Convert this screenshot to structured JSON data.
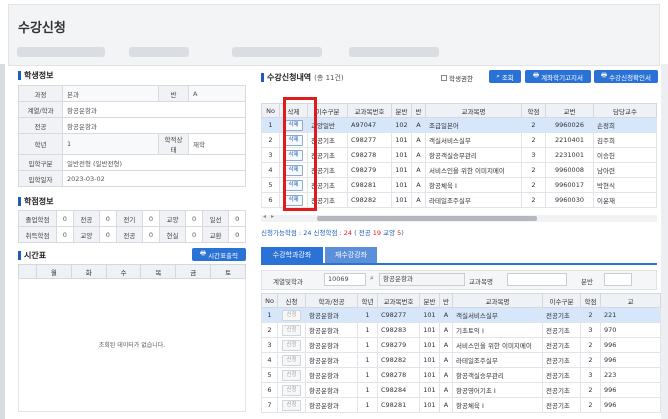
{
  "page": {
    "title": "수강신청"
  },
  "student": {
    "section_title": "학생정보",
    "rows": [
      {
        "label": "과정",
        "value": "본과",
        "label2": "반",
        "value2": "A"
      },
      {
        "label": "계열/학과",
        "value": "항공운항과"
      },
      {
        "label": "전공",
        "value": "항공운항과"
      },
      {
        "label": "학년",
        "value": "1",
        "label2": "학적상태",
        "value2": "재학"
      },
      {
        "label": "입학구분",
        "value": "일반전형 (일반전형)"
      },
      {
        "label": "입학일자",
        "value": "2023-03-02"
      }
    ]
  },
  "credits": {
    "section_title": "학점정보",
    "row1": {
      "label": "졸업학점",
      "cells": [
        "0",
        "전공",
        "0",
        "전기",
        "0",
        "교양",
        "0",
        "일선",
        "0"
      ]
    },
    "row2": {
      "label": "취득학점",
      "cells": [
        "0",
        "교양",
        "0",
        "전공",
        "0",
        "현실",
        "0",
        "교환",
        "0"
      ]
    }
  },
  "timetable": {
    "section_title": "시간표",
    "print_button": "시간표출력",
    "days": [
      "월",
      "화",
      "수",
      "목",
      "금",
      "토"
    ],
    "empty_message": "조회된 데이터가 없습니다."
  },
  "enroll": {
    "section_title": "수강신청내역",
    "count_text": "(총 11건)",
    "checkbox_label": "학생권한",
    "buttons": {
      "search": "조회",
      "notice": "계좌학기고지서",
      "confirm": "수강신청확인서"
    },
    "columns": [
      "No",
      "삭제",
      "이수구분",
      "교과목번호",
      "분반",
      "반",
      "교과목명",
      "학점",
      "교번",
      "담당교수"
    ],
    "rows": [
      {
        "no": "1",
        "del": "삭제",
        "type": "교양일반",
        "code": "A97047",
        "sec": "102",
        "ban": "A",
        "name": "조급일본어",
        "credit": "2",
        "prof_no": "9960026",
        "prof": "손정희"
      },
      {
        "no": "2",
        "del": "삭제",
        "type": "전공기초",
        "code": "C98277",
        "sec": "101",
        "ban": "A",
        "name": "객실서비스실무",
        "credit": "2",
        "prof_no": "2210401",
        "prof": "김주희"
      },
      {
        "no": "3",
        "del": "삭제",
        "type": "전공기초",
        "code": "C98278",
        "sec": "101",
        "ban": "A",
        "name": "항공객실승무관리",
        "credit": "3",
        "prof_no": "2231001",
        "prof": "이승헌"
      },
      {
        "no": "4",
        "del": "삭제",
        "type": "전공기초",
        "code": "C98279",
        "sec": "101",
        "ban": "A",
        "name": "서비스인을 위한 이미지메이",
        "credit": "2",
        "prof_no": "9960008",
        "prof": "남아련"
      },
      {
        "no": "5",
        "del": "삭제",
        "type": "전공기초",
        "code": "C98281",
        "sec": "101",
        "ban": "A",
        "name": "항공체육 I",
        "credit": "2",
        "prof_no": "9960017",
        "prof": "박현식"
      },
      {
        "no": "6",
        "del": "삭제",
        "type": "전공기초",
        "code": "C98282",
        "sec": "101",
        "ban": "A",
        "name": "라테일조주실무",
        "credit": "2",
        "prof_no": "9960030",
        "prof": "이윤재"
      }
    ],
    "summary_prefix": "신청가능학점 : 24 신청학점 : ",
    "summary_applied": "24",
    "summary_mid": " ( 전공 ",
    "summary_major": "19",
    "summary_mid2": " 교양 ",
    "summary_liberal": "5",
    "summary_end": ")"
  },
  "lower": {
    "tabs": [
      "수강학과강좌",
      "재수강강좌"
    ],
    "filter": {
      "dept_label": "계열및학과",
      "dept_code": "10069",
      "dept_name": "항공운항과",
      "course_label": "교과목명",
      "section_label": "분반"
    },
    "columns": [
      "No",
      "신청",
      "학과/전공",
      "학년",
      "교과목번호",
      "분반",
      "반",
      "교과목명",
      "이수구분",
      "학점",
      "교"
    ],
    "rows": [
      {
        "no": "1",
        "btn": "신청",
        "dept": "항공운항과",
        "yr": "1",
        "code": "C98277",
        "sec": "101",
        "ban": "A",
        "name": "객실서비스실무",
        "type": "전공기초",
        "credit": "2",
        "x": "221"
      },
      {
        "no": "2",
        "btn": "신청",
        "dept": "항공운항과",
        "yr": "1",
        "code": "C98283",
        "sec": "101",
        "ban": "A",
        "name": "기초토익 I",
        "type": "전공기초",
        "credit": "3",
        "x": "970"
      },
      {
        "no": "3",
        "btn": "신청",
        "dept": "항공운항과",
        "yr": "1",
        "code": "C98279",
        "sec": "101",
        "ban": "A",
        "name": "서비스인을 위한 이미지메이",
        "type": "전공기초",
        "credit": "2",
        "x": "996"
      },
      {
        "no": "4",
        "btn": "신청",
        "dept": "항공운항과",
        "yr": "1",
        "code": "C98282",
        "sec": "101",
        "ban": "A",
        "name": "라테일조주실무",
        "type": "전공기초",
        "credit": "2",
        "x": "996"
      },
      {
        "no": "5",
        "btn": "신청",
        "dept": "항공운항과",
        "yr": "1",
        "code": "C98278",
        "sec": "101",
        "ban": "A",
        "name": "항공객실승무관리",
        "type": "전공기초",
        "credit": "3",
        "x": "223"
      },
      {
        "no": "6",
        "btn": "신청",
        "dept": "항공운항과",
        "yr": "1",
        "code": "C98284",
        "sec": "101",
        "ban": "A",
        "name": "항공영어기초 I",
        "type": "전공기초",
        "credit": "2",
        "x": "996"
      },
      {
        "no": "7",
        "btn": "신청",
        "dept": "항공운항과",
        "yr": "1",
        "code": "C98281",
        "sec": "101",
        "ban": "A",
        "name": "항공체육 I",
        "type": "전공기초",
        "credit": "2",
        "x": "996"
      }
    ]
  },
  "colors": {
    "accent": "#2a72d6",
    "highlight": "#e11b1b",
    "tab_active": "#2a72d6",
    "tab_inactive": "#5b8fd9"
  }
}
